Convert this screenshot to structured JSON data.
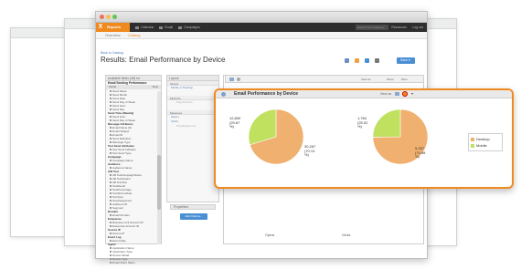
{
  "app": {
    "name": "Reports",
    "nav": [
      "Calendar",
      "Email",
      "Campaigns"
    ],
    "search_placeholder": "Search Your Audience",
    "nav_right": [
      "Resources",
      "Log out"
    ]
  },
  "subnav": {
    "tabs": [
      "Overview",
      "Catalog"
    ]
  },
  "back_link": "Back to Catalog",
  "page_title": "Results: Email Performance by Device",
  "save_label": "Save",
  "field_panel": {
    "search_placeholder": "available fields (48) for",
    "data_source": "Email Sending Performance",
    "col_headers": [
      "Fields",
      "View"
    ],
    "fields": [
      {
        "label": "Send Week",
        "group": false
      },
      {
        "label": "Send Month",
        "group": false
      },
      {
        "label": "Send Date",
        "group": false
      },
      {
        "label": "Send Day of Week",
        "group": false
      },
      {
        "label": "Send Hour",
        "group": false
      },
      {
        "label": "Send Day",
        "group": false
      },
      {
        "label": "Send Time (Weekly)",
        "group": true
      },
      {
        "label": "Send Hour",
        "group": false
      },
      {
        "label": "Send Day of Week",
        "group": false
      },
      {
        "label": "Message Attributes",
        "group": true
      },
      {
        "label": "Email Name (#)",
        "group": false
      },
      {
        "label": "Email Subject",
        "group": false
      },
      {
        "label": "Email ID",
        "group": false
      },
      {
        "label": "Send Definition",
        "group": false
      },
      {
        "label": "Message Type",
        "group": false
      },
      {
        "label": "Test Send Attributes",
        "group": true
      },
      {
        "label": "Test Send Indicator",
        "group": false
      },
      {
        "label": "Test Send Type",
        "group": false
      },
      {
        "label": "Campaign",
        "group": true
      },
      {
        "label": "Campaign Name",
        "group": false
      },
      {
        "label": "Audience",
        "group": true
      },
      {
        "label": "Audience Name",
        "group": false
      },
      {
        "label": "A/B Test",
        "group": true
      },
      {
        "label": "AB TestCampaignName",
        "group": false
      },
      {
        "label": "AB TestVariant",
        "group": false
      },
      {
        "label": "AB TestTest",
        "group": false
      },
      {
        "label": "TestResult",
        "group": false
      },
      {
        "label": "TestPercentage",
        "group": false
      },
      {
        "label": "TestWinnerDate",
        "group": false
      },
      {
        "label": "TestType",
        "group": false
      },
      {
        "label": "TestAssignment",
        "group": false
      },
      {
        "label": "Audience ID",
        "group": false
      },
      {
        "label": "Segment",
        "group": false
      },
      {
        "label": "Domain",
        "group": true
      },
      {
        "label": "Email Domain",
        "group": false
      },
      {
        "label": "Enterprise",
        "group": true
      },
      {
        "label": "Business Unit Account ID",
        "group": false
      },
      {
        "label": "Enterprise Account ID",
        "group": false
      },
      {
        "label": "Source IP",
        "group": true
      },
      {
        "label": "Source IP",
        "group": false
      },
      {
        "label": "Event Log",
        "group": true
      },
      {
        "label": "Event Date",
        "group": false
      },
      {
        "label": "Agent",
        "group": true
      },
      {
        "label": "Application Name",
        "group": false
      },
      {
        "label": "Application Type",
        "group": false
      },
      {
        "label": "Device Model",
        "group": false
      },
      {
        "label": "Device Type",
        "group": false
      },
      {
        "label": "Email Client Name",
        "group": false
      }
    ]
  },
  "layout_panel": {
    "header": "Layout",
    "sections": [
      {
        "title": "Shows",
        "items": [
          "Mobile or Desktop"
        ],
        "hint": ""
      },
      {
        "title": "Multi-Pie",
        "items": [],
        "hint": "Drag fields here"
      },
      {
        "title": "Measures",
        "items": [
          "Opens",
          "Clicks"
        ],
        "hint": "Drag Measure here"
      }
    ],
    "properties_label": "Properties",
    "add_button": "Add Options..."
  },
  "chart_toolbar": {
    "view_as": "View as",
    "actions": [
      "Show",
      "More"
    ]
  },
  "chart_data": {
    "type": "pie",
    "title": "Email Performance by Device",
    "categories": [
      "Desktop",
      "Mobile"
    ],
    "colors": [
      "#f0b070",
      "#c0e060"
    ],
    "series": [
      {
        "name": "Opens",
        "values": [
          30287,
          12800
        ],
        "labels": [
          "30,287\n(70.13\n%)",
          "12,800\n(29.87\n%)"
        ]
      },
      {
        "name": "Clicks",
        "values": [
          5287,
          1784
        ],
        "labels": [
          "5,287\n(74.98\n%)",
          "1,784\n(25.02\n%)"
        ]
      }
    ],
    "legend": "right"
  },
  "icons": [
    "orange-x-logo",
    "filter-icon",
    "download-icon",
    "settings-icon",
    "share-icon"
  ]
}
